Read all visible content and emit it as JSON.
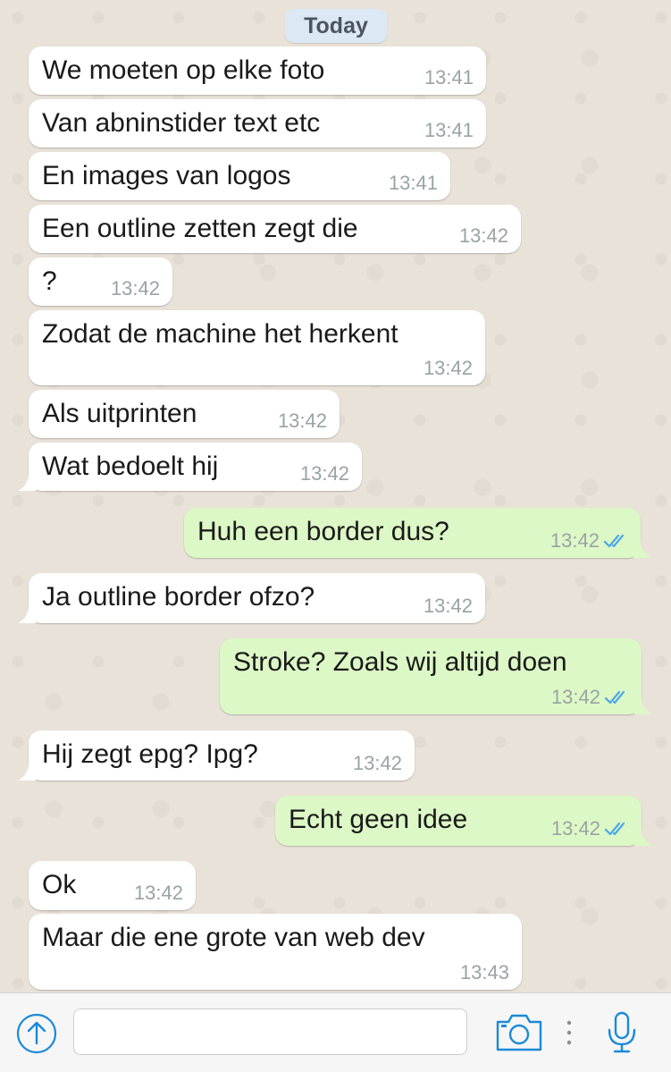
{
  "date_divider": "Today",
  "messages": [
    {
      "dir": "in",
      "text": "We moeten op elke foto",
      "time": "13:41"
    },
    {
      "dir": "in",
      "text": "Van abninstider text etc",
      "time": "13:41"
    },
    {
      "dir": "in",
      "text": "En images van logos",
      "time": "13:41"
    },
    {
      "dir": "in",
      "text": "Een outline zetten zegt die",
      "time": "13:42"
    },
    {
      "dir": "in",
      "text": "?",
      "time": "13:42"
    },
    {
      "dir": "in",
      "text": "Zodat de machine het herkent",
      "time": "13:42"
    },
    {
      "dir": "in",
      "text": "Als uitprinten",
      "time": "13:42"
    },
    {
      "dir": "in",
      "text": "Wat bedoelt hij",
      "time": "13:42"
    },
    {
      "dir": "out",
      "text": "Huh een border dus?",
      "time": "13:42",
      "status": "read"
    },
    {
      "dir": "in",
      "text": "Ja outline border ofzo?",
      "time": "13:42"
    },
    {
      "dir": "out",
      "text": "Stroke? Zoals wij altijd doen",
      "time": "13:42",
      "status": "read"
    },
    {
      "dir": "in",
      "text": "Hij zegt epg? Ipg?",
      "time": "13:42"
    },
    {
      "dir": "out",
      "text": "Echt geen idee",
      "time": "13:42",
      "status": "read"
    },
    {
      "dir": "in",
      "text": "Ok",
      "time": "13:42"
    },
    {
      "dir": "in",
      "text": "Maar die ene grote van web dev",
      "time": "13:43"
    }
  ],
  "input": {
    "value": "",
    "placeholder": ""
  },
  "icons": {
    "attach": "plus-circle-icon",
    "camera": "camera-icon",
    "more": "vertical-dots-icon",
    "mic": "microphone-icon"
  },
  "colors": {
    "incoming": "#ffffff",
    "outgoing": "#dcf8c6",
    "read_receipt": "#4fa6e6",
    "accent": "#1a8ad8",
    "date_pill": "#dce8f4"
  }
}
